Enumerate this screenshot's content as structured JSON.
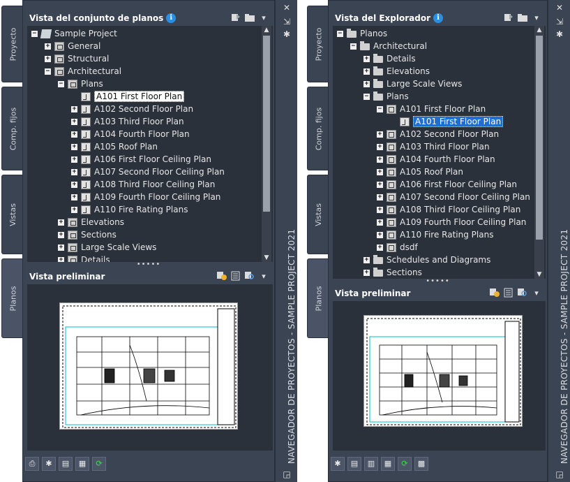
{
  "left": {
    "side_tabs": [
      "Proyecto",
      "Comp. fijos",
      "Vistas",
      "Planos"
    ],
    "vertical_title": "NAVEGADOR DE PROYECTOS - SAMPLE PROJECT 2021",
    "tree_header": "Vista del conjunto de planos",
    "preview_header": "Vista preliminar",
    "tree": [
      {
        "label": "Sample Project",
        "expander": "−",
        "icon": "sheetset",
        "indent": 0
      },
      {
        "label": "General",
        "expander": "+",
        "icon": "subset",
        "indent": 1
      },
      {
        "label": "Structural",
        "expander": "+",
        "icon": "subset",
        "indent": 1
      },
      {
        "label": "Architectural",
        "expander": "−",
        "icon": "subset",
        "indent": 1
      },
      {
        "label": "Plans",
        "expander": "−",
        "icon": "subset",
        "indent": 2
      },
      {
        "label": "A101 First Floor Plan",
        "expander": "",
        "icon": "viewsheet",
        "indent": 3,
        "selected": true
      },
      {
        "label": "A102 Second Floor Plan",
        "expander": "+",
        "icon": "viewsheet",
        "indent": 3
      },
      {
        "label": "A103 Third Floor Plan",
        "expander": "+",
        "icon": "viewsheet",
        "indent": 3
      },
      {
        "label": "A104 Fourth Floor Plan",
        "expander": "+",
        "icon": "viewsheet",
        "indent": 3
      },
      {
        "label": "A105 Roof Plan",
        "expander": "+",
        "icon": "viewsheet",
        "indent": 3
      },
      {
        "label": "A106 First Floor Ceiling Plan",
        "expander": "+",
        "icon": "viewsheet",
        "indent": 3
      },
      {
        "label": "A107 Second Floor Ceiling Plan",
        "expander": "+",
        "icon": "viewsheet",
        "indent": 3
      },
      {
        "label": "A108 Third Floor Ceiling Plan",
        "expander": "+",
        "icon": "viewsheet",
        "indent": 3
      },
      {
        "label": "A109 Fourth Floor Ceiling Plan",
        "expander": "+",
        "icon": "viewsheet",
        "indent": 3
      },
      {
        "label": "A110 Fire Rating Plans",
        "expander": "+",
        "icon": "viewsheet",
        "indent": 3
      },
      {
        "label": "Elevations",
        "expander": "+",
        "icon": "subset",
        "indent": 2
      },
      {
        "label": "Sections",
        "expander": "+",
        "icon": "subset",
        "indent": 2
      },
      {
        "label": "Large Scale Views",
        "expander": "+",
        "icon": "subset",
        "indent": 2
      },
      {
        "label": "Details",
        "expander": "+",
        "icon": "subset",
        "indent": 2
      }
    ]
  },
  "right": {
    "side_tabs": [
      "Proyecto",
      "Comp. fijos",
      "Vistas",
      "Planos"
    ],
    "vertical_title": "NAVEGADOR DE PROYECTOS - SAMPLE PROJECT 2021",
    "tree_header": "Vista del Explorador",
    "preview_header": "Vista preliminar",
    "tree": [
      {
        "label": "Planos",
        "expander": "−",
        "icon": "folder",
        "indent": 0
      },
      {
        "label": "Architectural",
        "expander": "−",
        "icon": "folder",
        "indent": 1
      },
      {
        "label": "Details",
        "expander": "+",
        "icon": "folder",
        "indent": 2
      },
      {
        "label": "Elevations",
        "expander": "+",
        "icon": "folder",
        "indent": 2
      },
      {
        "label": "Large Scale Views",
        "expander": "+",
        "icon": "folder",
        "indent": 2
      },
      {
        "label": "Plans",
        "expander": "−",
        "icon": "folder",
        "indent": 2
      },
      {
        "label": "A101 First Floor Plan",
        "expander": "−",
        "icon": "sheet",
        "indent": 3
      },
      {
        "label": "A101 First Floor Plan",
        "expander": "",
        "icon": "viewsheet",
        "indent": 4,
        "selected": true
      },
      {
        "label": "A102 Second Floor Plan",
        "expander": "+",
        "icon": "sheet",
        "indent": 3
      },
      {
        "label": "A103 Third Floor Plan",
        "expander": "+",
        "icon": "sheet",
        "indent": 3
      },
      {
        "label": "A104 Fourth Floor Plan",
        "expander": "+",
        "icon": "sheet",
        "indent": 3
      },
      {
        "label": "A105 Roof Plan",
        "expander": "+",
        "icon": "sheet",
        "indent": 3
      },
      {
        "label": "A106 First Floor Ceiling Plan",
        "expander": "+",
        "icon": "sheet",
        "indent": 3
      },
      {
        "label": "A107 Second Floor Ceiling Plan",
        "expander": "+",
        "icon": "sheet",
        "indent": 3
      },
      {
        "label": "A108 Third Floor Ceiling Plan",
        "expander": "+",
        "icon": "sheet",
        "indent": 3
      },
      {
        "label": "A109 Fourth Floor Ceiling Plan",
        "expander": "+",
        "icon": "sheet",
        "indent": 3
      },
      {
        "label": "A110 Fire Rating Plans",
        "expander": "+",
        "icon": "sheet",
        "indent": 3
      },
      {
        "label": "dsdf",
        "expander": "+",
        "icon": "sheet",
        "indent": 3
      },
      {
        "label": "Schedules and Diagrams",
        "expander": "+",
        "icon": "folder",
        "indent": 2
      },
      {
        "label": "Sections",
        "expander": "+",
        "icon": "folder",
        "indent": 2
      }
    ]
  },
  "icons": {
    "info": "info-icon",
    "close": "close-icon",
    "pin": "pin-icon",
    "settings": "settings-icon",
    "dropdown": "chevron-down-icon"
  },
  "glyphs": {
    "info": "i",
    "close": "✕",
    "pin": "⇲",
    "settings": "✱",
    "dropdown": "▾",
    "scroll_up": "▲",
    "scroll_down": "▼",
    "grip": "•••••",
    "corner": "◲"
  },
  "colors": {
    "panel": "#3b4453",
    "tree_bg": "#2b313b",
    "selection_blue": "#1f6fd0",
    "accent_info": "#2b8ee0",
    "refresh_green": "#3cc44a"
  }
}
